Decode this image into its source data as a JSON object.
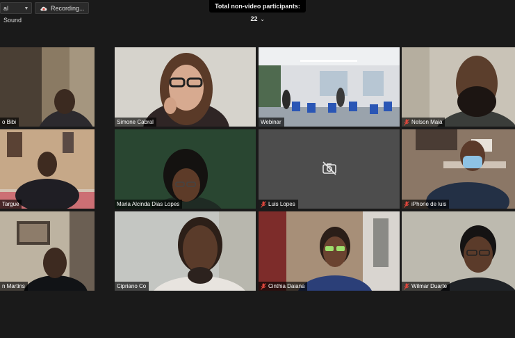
{
  "topbar": {
    "sound_label": "al Sound",
    "recording_label": "Recording...",
    "participants_label": "Total non-video participants: 22"
  },
  "tiles": [
    {
      "name": "o Bibi",
      "muted": false
    },
    {
      "name": "Simone Cabral",
      "muted": false
    },
    {
      "name": "Webinar",
      "muted": false
    },
    {
      "name": "Nelson Maia",
      "muted": true
    },
    {
      "name": "Targue",
      "muted": false
    },
    {
      "name": "Maria Alcinda Dias Lopes",
      "muted": false
    },
    {
      "name": "Luis Lopes",
      "muted": true
    },
    {
      "name": "iPhone de luis",
      "muted": true
    },
    {
      "name": "n Martins",
      "muted": false
    },
    {
      "name": "Cipriano Co",
      "muted": false
    },
    {
      "name": "Cinthia Daiana",
      "muted": true
    },
    {
      "name": "Wilmar Duarte",
      "muted": true
    }
  ],
  "colors": {
    "active_speaker": "#9fd34a",
    "muted_mic": "#e0463c"
  },
  "icons": [
    "chevron-down-icon",
    "cloud-recording-icon",
    "camera-off-icon",
    "mic-muted-icon"
  ]
}
